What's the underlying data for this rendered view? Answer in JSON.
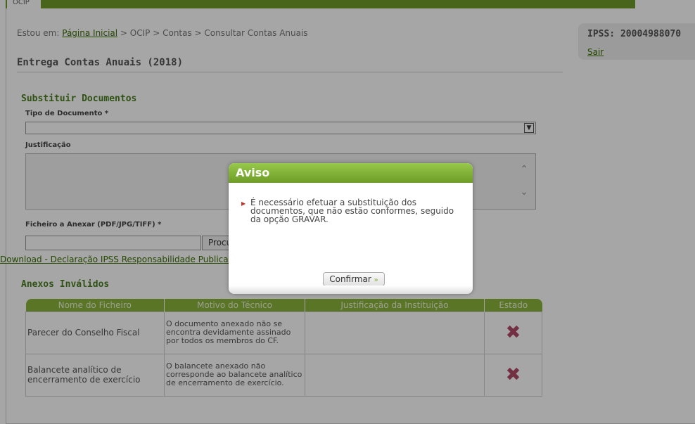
{
  "header": {
    "tab": "OCIP"
  },
  "breadcrumb": {
    "prefix": "Estou em:",
    "home": "Página Inicial",
    "trail": " > OCIP > Contas > Consultar Contas Anuais"
  },
  "page_title": "Entrega Contas Anuais (2018)",
  "user": {
    "ipss": "IPSS: 20004988070",
    "logout": "Sair"
  },
  "substitute": {
    "title": "Substituir Documentos",
    "doc_type_label": "Tipo de Documento *",
    "doc_type_value": "",
    "justification_label": "Justificação",
    "file_label": "Ficheiro a Anexar (PDF/JPG/TIFF) *",
    "browse_label": "Procurar...",
    "download_link": "Download - Declaração IPSS Responsabilidade Publicação"
  },
  "invalid": {
    "title": "Anexos Inválidos",
    "headers": [
      "Nome do Ficheiro",
      "Motivo do Técnico",
      "Justificação da Instituição",
      "Estado"
    ],
    "rows": [
      {
        "file": "Parecer do Conselho Fiscal",
        "reason": "O documento anexado não se encontra devidamente assinado por todos os membros do CF.",
        "justification": "",
        "status": "invalid"
      },
      {
        "file": "Balancete analítico de encerramento de exercício",
        "reason": "O balancete anexado não corresponde ao balancete analítico de encerramento de exercício.",
        "justification": "",
        "status": "invalid"
      }
    ]
  },
  "modal": {
    "title": "Aviso",
    "message": "É necessário efetuar a substituição dos documentos, que não estão conformes, seguido da opção GRAVAR.",
    "confirm": "Confirmar"
  },
  "colors": {
    "accent": "#6f9b2a",
    "error_icon": "#b04a66"
  }
}
